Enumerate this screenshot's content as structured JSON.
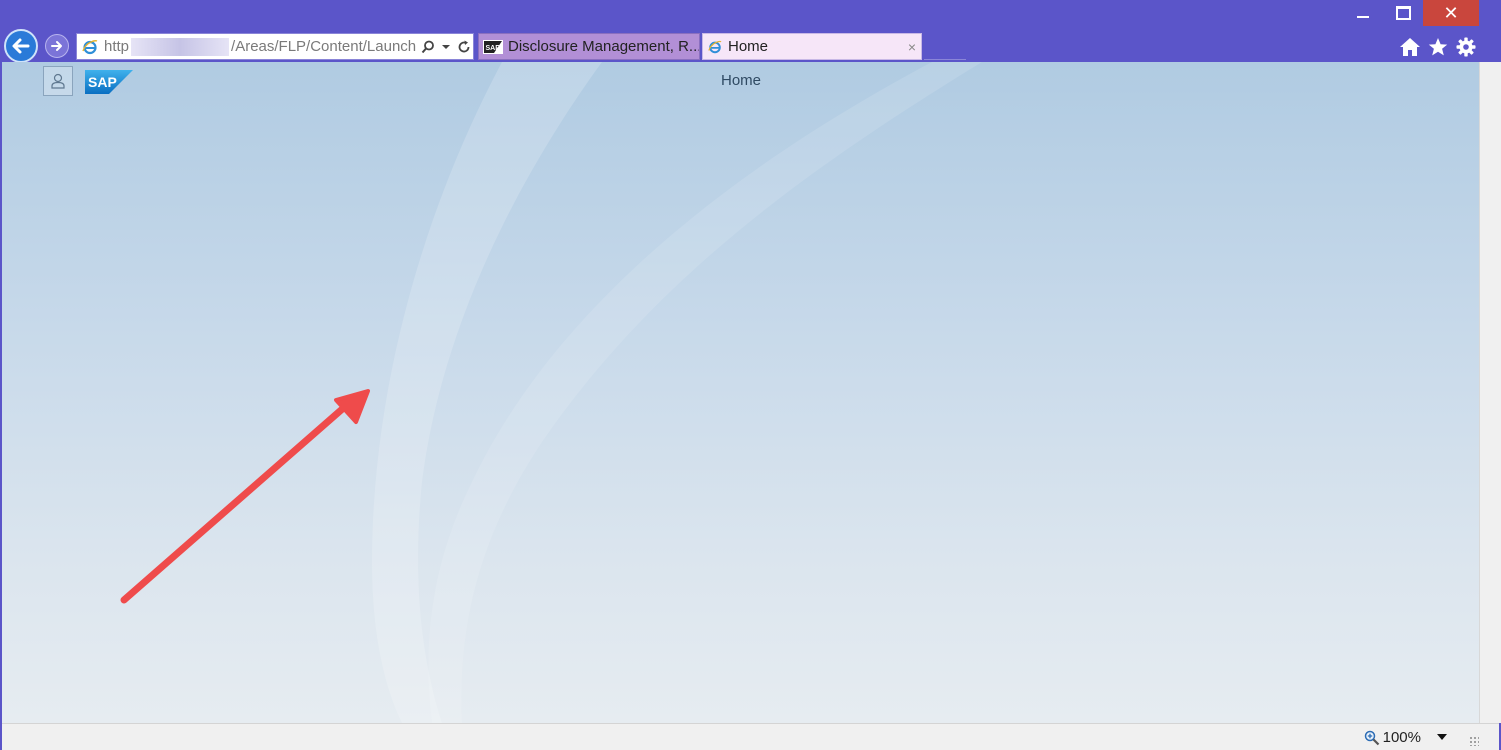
{
  "browser": {
    "address": {
      "url_start": "http",
      "url_end": "/Areas/FLP/Content/Launch"
    },
    "tabs": [
      {
        "label": "Disclosure Management, R...",
        "favicon": "sap-favicon",
        "active": false
      },
      {
        "label": "Home",
        "favicon": "ie-favicon",
        "active": true,
        "close": "×"
      }
    ],
    "window_controls": {
      "close": "✕"
    },
    "tools": [
      "home-icon",
      "star-icon",
      "gear-icon"
    ],
    "zoom": "100%"
  },
  "shell": {
    "logo": "SAP",
    "title": "Home",
    "user_icon": "user-icon"
  },
  "colors": {
    "chrome": "#5b55c9",
    "active_tab": "#f6e6f8",
    "inactive_tab": "#b28fd6",
    "sap_blue": "#1a8fd6",
    "arrow": "#ef4b4b",
    "close_button": "#c9463d"
  }
}
